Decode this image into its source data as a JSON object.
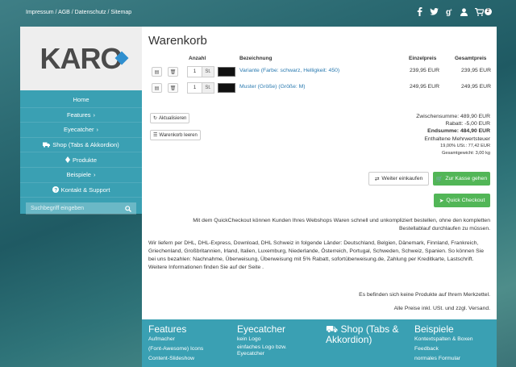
{
  "topbar": {
    "links": "Impressum / AGB / Datenschutz / Sitemap",
    "cart_count": "2",
    "icons": [
      "facebook-icon",
      "twitter-icon",
      "google-plus-icon",
      "user-icon",
      "cart-icon"
    ]
  },
  "logo": {
    "text": "KARO"
  },
  "sidebar": {
    "items": [
      {
        "label": "Home",
        "icon": ""
      },
      {
        "label": "Features",
        "icon": "",
        "suffix": "›"
      },
      {
        "label": "Eyecatcher",
        "icon": "",
        "suffix": "›"
      },
      {
        "label": "Shop (Tabs & Akkordion)",
        "icon": "truck-icon",
        "suffix": ""
      },
      {
        "label": "Produkte",
        "icon": "diamond-icon",
        "suffix": ""
      },
      {
        "label": "Beispiele",
        "icon": "",
        "suffix": "›"
      },
      {
        "label": "Kontakt & Support",
        "icon": "question-icon",
        "suffix": ""
      }
    ],
    "search_placeholder": "Suchbegriff eingeben"
  },
  "cart": {
    "title": "Warenkorb",
    "headers": {
      "anzahl": "Anzahl",
      "bezeichnung": "Bezeichnung",
      "einzelpreis": "Einzelpreis",
      "gesamtpreis": "Gesamtpreis"
    },
    "items": [
      {
        "qty": "1",
        "unit": "St.",
        "name": "Variante (Farbe: schwarz, Helligkeit: 450)",
        "unit_price": "239,95 EUR",
        "total": "239,95 EUR"
      },
      {
        "qty": "1",
        "unit": "St.",
        "name": "Muster (Größe) (Größe: M)",
        "unit_price": "249,95 EUR",
        "total": "249,95 EUR"
      }
    ],
    "update_label": "Aktualisieren",
    "clear_label": "Warenkorb leeren",
    "subtotal": "Zwischensumme: 489,90 EUR",
    "discount": "Rabatt: -5,00 EUR",
    "total": "Endsumme: 484,90 EUR",
    "vat_note": "Enthaltene Mehrwertsteuer",
    "vat_line": "19,00% USt.: 77,42 EUR",
    "weight": "Gesamtgewicht: 3,00 kg",
    "continue_label": "Weiter einkaufen",
    "checkout_label": "Zur Kasse gehen",
    "quick_checkout_label": "Quick Checkout",
    "quick_checkout_text": "Mit dem QuickCheckout können Kunden Ihres Webshops Waren schnell und unkompliziert bestellen, ohne den kompletten Bestellablauf durchlaufen zu müssen.",
    "shipping_text": "Wir liefern per DHL, DHL-Express, Download, DHL Schweiz in folgende Länder: Deutschland, Belgien, Dänemark, Finnland, Frankreich, Griechenland, Großbritannien, Irland, Italien, Luxemburg, Niederlande, Österreich, Portugal, Schweden, Schweiz, Spanien. So können Sie bei uns bezahlen: Nachnahme, Überweisung, Überweisung mit 5% Rabatt, sofortüberweisung.de, Zahlung per Kreditkarte, Lastschrift.",
    "more_info": "Weitere Informationen finden Sie auf der Seite .",
    "wishlist_note": "Es befinden sich keine Produkte auf Ihrem Merkzettel.",
    "price_note": "Alle Preise inkl. USt. und zzgl. Versand."
  },
  "footer": {
    "columns": [
      {
        "title": "Features",
        "items": [
          "Aufmacher",
          "(Font-Awesome) Icons",
          "Content-Slideshow"
        ]
      },
      {
        "title": "Eyecatcher",
        "items": [
          "kein Logo",
          "einfaches Logo bzw. Eyecatcher"
        ]
      },
      {
        "title": "Shop (Tabs & Akkordion)",
        "items": []
      },
      {
        "title": "Beispiele",
        "items": [
          "Kontextspalten & Boxen",
          "Feedback",
          "normales Formular"
        ]
      }
    ]
  },
  "colors": {
    "accent": "#3aa0b3",
    "button_green": "#52b657",
    "link": "#2a7ab0"
  }
}
